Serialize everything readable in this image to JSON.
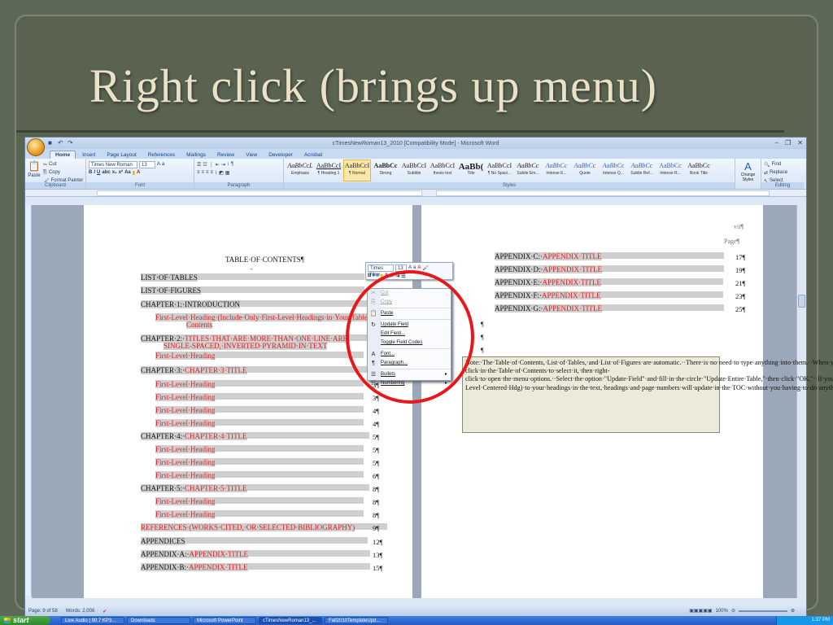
{
  "slide": {
    "title": "Right click (brings up menu)"
  },
  "word": {
    "window_title": "cTimesNewRoman13_2010 [Compatibility Mode] - Microsoft Word",
    "tabs": [
      "Home",
      "Insert",
      "Page Layout",
      "References",
      "Mailings",
      "Review",
      "View",
      "Developer",
      "Acrobat"
    ],
    "clipboard": {
      "cut": "Cut",
      "copy": "Copy",
      "paste": "Paste",
      "format_painter": "Format Painter",
      "label": "Clipboard"
    },
    "font": {
      "name": "Times New Roman",
      "size": "13",
      "label": "Font"
    },
    "paragraph_label": "Paragraph",
    "styles": [
      {
        "sample": "AaBbCcL",
        "name": "Emphasis"
      },
      {
        "sample": "AaBbCcI",
        "name": "¶ Heading 1"
      },
      {
        "sample": "AaBbCcI",
        "name": "¶ Normal"
      },
      {
        "sample": "AaBbCc",
        "name": "Strong"
      },
      {
        "sample": "AaBbCcI",
        "name": "Subtitle"
      },
      {
        "sample": "AaBbCcI",
        "name": "thesis text"
      },
      {
        "sample": "AaBb(",
        "name": "Title"
      },
      {
        "sample": "AaBbCcI",
        "name": "¶ No Spaci..."
      },
      {
        "sample": "AaBbCc",
        "name": "Subtle Em..."
      },
      {
        "sample": "AaBbCc",
        "name": "Intense E..."
      },
      {
        "sample": "AaBbCc",
        "name": "Quote"
      },
      {
        "sample": "AaBbCc",
        "name": "Intense Q..."
      },
      {
        "sample": "AaBbCc",
        "name": "Subtle Ref..."
      },
      {
        "sample": "AaBbCc",
        "name": "Intense R..."
      },
      {
        "sample": "AaBbCc",
        "name": "Book Title"
      }
    ],
    "styles_label": "Styles",
    "change_styles": "Change Styles",
    "editing": {
      "find": "Find",
      "replace": "Replace",
      "select": "Select",
      "label": "Editing"
    },
    "status": {
      "page": "Page: 9 of 58",
      "words": "Words: 2,008",
      "zoom": "100%"
    }
  },
  "document": {
    "left": {
      "toc_title": "TABLE·OF·CONTENTS¶",
      "entries": [
        {
          "text": "LIST·OF·TABLES",
          "num": ""
        },
        {
          "text": "LIST·OF·FIGURES",
          "num": ""
        },
        {
          "text": "CHAPTER·1:·INTRODUCTION",
          "num": ""
        },
        {
          "text": "First-Level·Heading·(Include·Only·First-Level·Headings·in·Your·Table·of·",
          "text2": "Contents",
          "num": "",
          "red": true
        },
        {
          "text": "CHAPTER·2:·TITLES·THAT·ARE·MORE·THAN·ONE·LINE·ARE·",
          "text2": "SINGLE-SPACED,·INVERTED·PYRAMID·IN·TEXT",
          "num": "",
          "mixed": true
        },
        {
          "text": "First-Level·Heading",
          "num": "",
          "red": true
        },
        {
          "text": "CHAPTER·3:·CHAPTER·3·TITLE",
          "num": "3¶",
          "mixed": true
        },
        {
          "text": "First-Level·Heading",
          "num": "3¶",
          "red": true
        },
        {
          "text": "First-Level·Heading",
          "num": "3¶",
          "red": true
        },
        {
          "text": "First-Level·Heading",
          "num": "4¶",
          "red": true
        },
        {
          "text": "First-Level·Heading",
          "num": "4¶",
          "red": true
        },
        {
          "text": "CHAPTER·4:·CHAPTER·4·TITLE",
          "num": "5¶",
          "mixed": true
        },
        {
          "text": "First-Level·Heading",
          "num": "5¶",
          "red": true
        },
        {
          "text": "First-Level·Heading",
          "num": "5¶",
          "red": true
        },
        {
          "text": "First-Level·Heading",
          "num": "6¶",
          "red": true
        },
        {
          "text": "CHAPTER·5:·CHAPTER·5·TITLE",
          "num": "8¶",
          "mixed": true
        },
        {
          "text": "First-Level·Heading",
          "num": "8¶",
          "red": true
        },
        {
          "text": "First-Level·Heading",
          "num": "8¶",
          "red": true
        },
        {
          "text": "REFERENCES·(WORKS·CITED,·OR·SELECTED·BIBLIOGRAPHY)",
          "num": "9¶",
          "red": true
        },
        {
          "text": "APPENDICES",
          "num": "12¶"
        },
        {
          "text": "APPENDIX·A:·APPENDIX·TITLE",
          "num": "13¶",
          "mixed": true
        },
        {
          "text": "APPENDIX·B:·APPENDIX·TITLE",
          "num": "15¶",
          "mixed": true
        }
      ]
    },
    "right": {
      "page_no": "vii¶",
      "page_label": "Page¶",
      "entries": [
        {
          "text": "APPENDIX·C:·APPENDIX·TITLE",
          "num": "17¶"
        },
        {
          "text": "APPENDIX·D:·APPENDIX·TITLE",
          "num": "19¶"
        },
        {
          "text": "APPENDIX·E:·APPENDIX·TITLE",
          "num": "21¶"
        },
        {
          "text": "APPENDIX·F:·APPENDIX·TITLE",
          "num": "23¶"
        },
        {
          "text": "APPENDIX·G:·APPENDIX·TITLE",
          "num": "25¶"
        }
      ],
      "note": "Note:·The·Table·of·Contents,·List·of·Tables,·and·List·of·Figures·are·automatic.··There·is·no·need·to·type·anything·into·them.··When·you·have·finished·adding·all·text·to·the·template,·simply·single-click·in·the·Table·of·Contents·to·select·it,·then·right-click·to·open·the·menu·options.··Select·the·option·\"Update·Field\"·and·fill·in·the·circle·\"Update·Entire·Table,\"·then·click·\"OK.\"··If·you·have·applied·the·appropriate·style·(e.g.,·1st-Level·Centered·Hdg)·to·your·headings·in·the·text,·headings·and·page·numbers·will·update·in·the·TOC·without·you·having·to·do·anything.··Delete·this·text·box·when·you·are·finished.¶"
    }
  },
  "mini_toolbar": {
    "font": "Times New",
    "size": "13"
  },
  "context_menu": [
    {
      "label": "Cut",
      "enabled": false,
      "icon": "scissors-icon",
      "glyph": "✂"
    },
    {
      "label": "Copy",
      "enabled": false,
      "icon": "copy-icon",
      "glyph": "⎘"
    },
    {
      "label": "Paste",
      "enabled": true,
      "icon": "paste-icon",
      "glyph": "📋"
    },
    {
      "label": "Update Field",
      "enabled": true,
      "icon": "update-field-icon",
      "glyph": "↻"
    },
    {
      "label": "Edit Field...",
      "enabled": true,
      "icon": "",
      "glyph": ""
    },
    {
      "label": "Toggle Field Codes",
      "enabled": true,
      "icon": "",
      "glyph": ""
    },
    {
      "label": "Font...",
      "enabled": true,
      "icon": "font-icon",
      "glyph": "A"
    },
    {
      "label": "Paragraph...",
      "enabled": true,
      "icon": "paragraph-icon",
      "glyph": "¶"
    },
    {
      "label": "Bullets",
      "enabled": true,
      "icon": "bullets-icon",
      "glyph": "☰",
      "submenu": true
    },
    {
      "label": "Numbering",
      "enabled": true,
      "icon": "numbering-icon",
      "glyph": "☷",
      "submenu": true
    }
  ],
  "taskbar": {
    "start": "start",
    "items": [
      "Live Audio | 90.7 KP3...",
      "Downloads",
      "Microsoft PowerPoint",
      "cTimesNewRoman13_...",
      "Fall2010TemplateUpd..."
    ],
    "clock": "1:37 PM"
  },
  "colors": {
    "accent_red": "#e8181a",
    "heading_red": "#e02020",
    "title_color": "#e9e2c6"
  }
}
